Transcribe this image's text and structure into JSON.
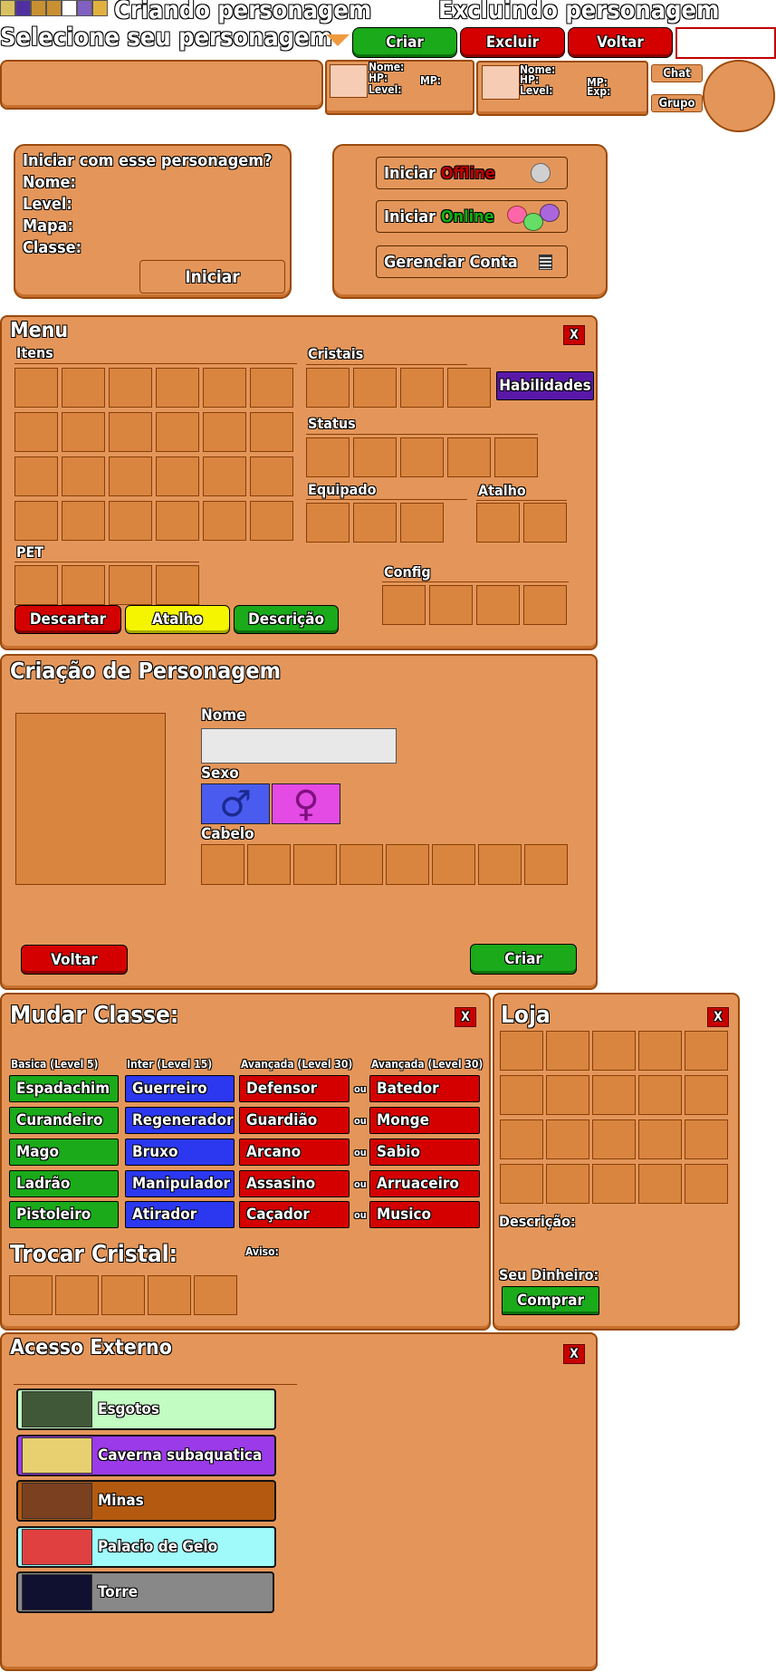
{
  "top": {
    "title_create": "Criando personagem",
    "title_delete": "Excluindo personagem",
    "select_label": "Selecione seu personagem",
    "btn_create": "Criar",
    "btn_delete": "Excluir",
    "btn_back": "Voltar"
  },
  "hud1": {
    "name": "Nome:",
    "hp": "HP:",
    "mp": "MP:",
    "level": "Level:"
  },
  "hud2": {
    "name": "Nome:",
    "hp": "HP:",
    "mp": "MP:",
    "level": "Level:",
    "exp": "Exp:"
  },
  "side": {
    "chat": "Chat",
    "group": "Grupo"
  },
  "start": {
    "question": "Iniciar com esse personagem?",
    "name": "Nome:",
    "level": "Level:",
    "map": "Mapa:",
    "class": "Classe:",
    "btn": "Iniciar"
  },
  "mode": {
    "prefix": "Iniciar",
    "offline": "Offline",
    "online": "Online",
    "manage": "Gerenciar Conta"
  },
  "menu": {
    "title": "Menu",
    "close": "X",
    "items": "Itens",
    "crystals": "Cristais",
    "skills": "Habilidades",
    "status": "Status",
    "equipped": "Equipado",
    "shortcut": "Atalho",
    "pet": "PET",
    "config": "Config",
    "discard": "Descartar",
    "shortcut_btn": "Atalho",
    "description": "Descrição"
  },
  "creation": {
    "title": "Criação de Personagem",
    "name": "Nome",
    "sex": "Sexo",
    "hair": "Cabelo",
    "male": "♂",
    "female": "♀",
    "back": "Voltar",
    "create": "Criar"
  },
  "classes": {
    "title": "Mudar Classe:",
    "close": "X",
    "h_basic": "Basica (Level 5)",
    "h_inter": "Inter (Level 15)",
    "h_adv1": "Avançada (Level 30)",
    "h_adv2": "Avançada (Level 30)",
    "or": "ou",
    "basic": [
      "Espadachim",
      "Curandeiro",
      "Mago",
      "Ladrão",
      "Pistoleiro"
    ],
    "inter": [
      "Guerreiro",
      "Regenerador",
      "Bruxo",
      "Manipulador",
      "Atirador"
    ],
    "adv1": [
      "Defensor",
      "Guardião",
      "Arcano",
      "Assasino",
      "Caçador"
    ],
    "adv2": [
      "Batedor",
      "Monge",
      "Sabio",
      "Arruaceiro",
      "Musico"
    ],
    "swap_title": "Trocar Cristal:",
    "notice": "Aviso:"
  },
  "shop": {
    "title": "Loja",
    "close": "X",
    "description": "Descrição:",
    "money": "Seu Dinheiro:",
    "buy": "Comprar"
  },
  "external": {
    "title": "Acesso Externo",
    "close": "X",
    "places": [
      {
        "name": "Esgotos",
        "color": "#c2fcc2"
      },
      {
        "name": "Caverna subaquatica",
        "color": "#9b3ae8"
      },
      {
        "name": "Minas",
        "color": "#b45a10"
      },
      {
        "name": "Palacio de Gelo",
        "color": "#a0fafa"
      },
      {
        "name": "Torre",
        "color": "#888888"
      }
    ]
  }
}
